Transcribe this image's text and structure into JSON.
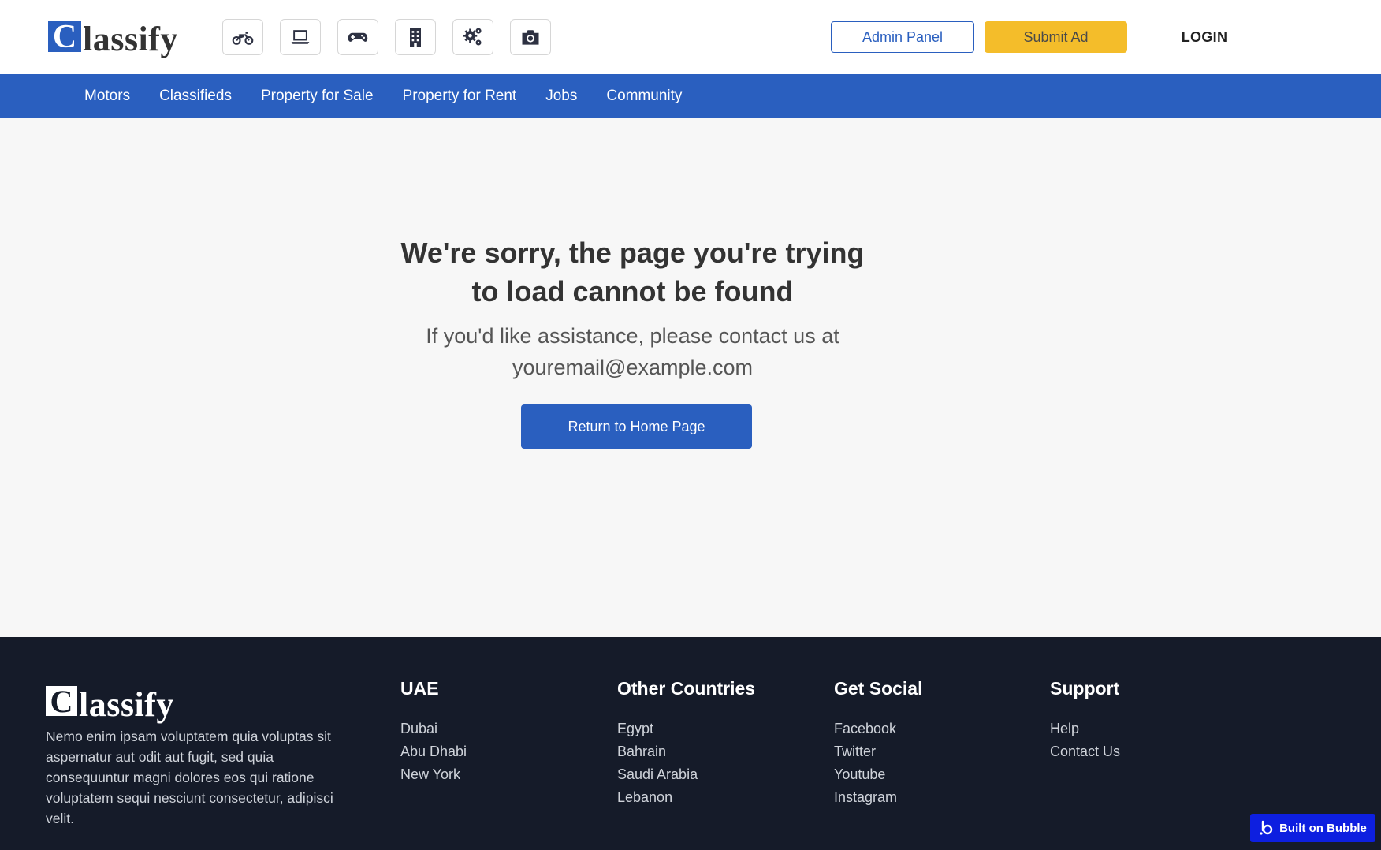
{
  "header": {
    "logo": {
      "initial": "C",
      "rest": "lassify"
    },
    "categories": [
      {
        "icon": "motorcycle-icon"
      },
      {
        "icon": "laptop-icon"
      },
      {
        "icon": "gamepad-icon"
      },
      {
        "icon": "building-icon"
      },
      {
        "icon": "gears-icon"
      },
      {
        "icon": "camera-icon"
      }
    ],
    "admin_label": "Admin Panel",
    "submit_label": "Submit Ad",
    "login_label": "LOGIN"
  },
  "nav": {
    "items": [
      "Motors",
      "Classifieds",
      "Property for Sale",
      "Property for Rent",
      "Jobs",
      "Community"
    ]
  },
  "main": {
    "title_line1": "We're sorry, the page you're trying",
    "title_line2": "to load cannot be found",
    "subtitle_line1": "If you'd like assistance, please contact us at",
    "subtitle_line2": "youremail@example.com",
    "home_button": "Return to Home Page"
  },
  "footer": {
    "logo": {
      "initial": "C",
      "rest": "lassify"
    },
    "description": "Nemo enim ipsam voluptatem quia voluptas sit aspernatur aut odit aut fugit, sed quia consequuntur magni dolores eos qui ratione voluptatem sequi nesciunt consectetur, adipisci velit.",
    "columns": [
      {
        "title": "UAE",
        "links": [
          "Dubai",
          "Abu Dhabi",
          "New York"
        ]
      },
      {
        "title": "Other Countries",
        "links": [
          "Egypt",
          "Bahrain",
          "Saudi Arabia",
          "Lebanon"
        ]
      },
      {
        "title": "Get Social",
        "links": [
          "Facebook",
          "Twitter",
          "Youtube",
          "Instagram"
        ]
      },
      {
        "title": "Support",
        "links": [
          "Help",
          "Contact Us"
        ]
      }
    ]
  },
  "badge": {
    "label": "Built on Bubble",
    "color": "#0d1fe0"
  },
  "colors": {
    "primary": "#2a5fbf",
    "accent": "#f4bd2a",
    "footer_bg": "#151b29"
  }
}
